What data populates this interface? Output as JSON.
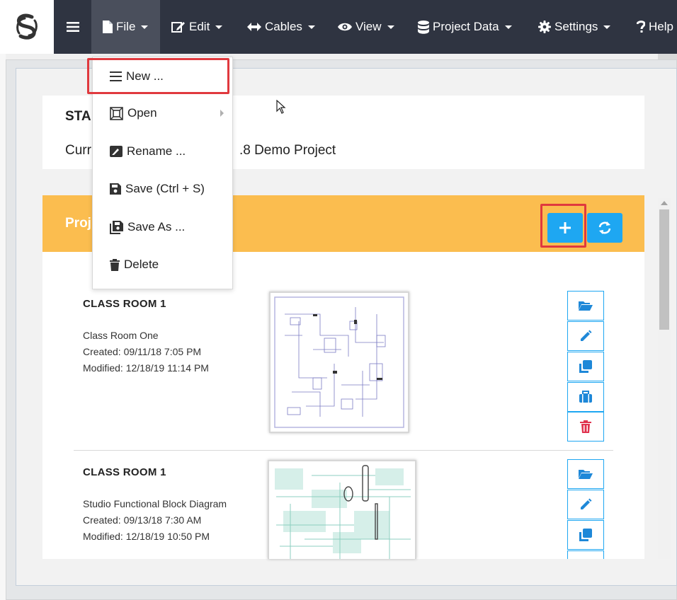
{
  "navbar": {
    "logo": "sd-logo-icon",
    "menu_toggle_icon": "hamburger-icon",
    "items": [
      {
        "label": "File",
        "icon": "file-icon"
      },
      {
        "label": "Edit",
        "icon": "edit-icon"
      },
      {
        "label": "Cables",
        "icon": "arrows-horizontal-icon"
      },
      {
        "label": "View",
        "icon": "eye-icon"
      },
      {
        "label": "Project Data",
        "icon": "database-icon"
      },
      {
        "label": "Settings",
        "icon": "gear-icon"
      },
      {
        "label": "Help",
        "icon": "question-icon"
      }
    ]
  },
  "file_menu": {
    "items": [
      {
        "label": "New ...",
        "icon": "list-icon",
        "highlighted": true
      },
      {
        "label": "Open",
        "icon": "open-icon",
        "has_submenu": true
      },
      {
        "label": "Rename ...",
        "icon": "rename-icon"
      },
      {
        "label": "Save (Ctrl + S)",
        "icon": "save-icon"
      },
      {
        "label": "Save As ...",
        "icon": "save-as-icon"
      },
      {
        "label": "Delete",
        "icon": "trash-icon"
      }
    ]
  },
  "status": {
    "title": "STA",
    "current": "Curr",
    "current_suffix": ".8 Demo Project"
  },
  "projects": {
    "title": "Proj",
    "add_button_icon": "plus-icon",
    "refresh_button_icon": "refresh-icon",
    "items": [
      {
        "name": "CLASS ROOM 1",
        "description": "Class Room One",
        "created": "Created: 09/11/18 7:05 PM",
        "modified": "Modified: 12/18/19 11:14 PM"
      },
      {
        "name": "CLASS ROOM 1",
        "description": "Studio Functional Block Diagram",
        "created": "Created: 09/13/18 7:30 AM",
        "modified": "Modified: 12/18/19 10:50 PM"
      }
    ],
    "row_actions": [
      "folder-open-icon",
      "pencil-icon",
      "copy-icon",
      "briefcase-icon",
      "trash-icon"
    ]
  },
  "colors": {
    "navbar": "#2f3441",
    "accent": "#1ea7f2",
    "header": "#fbbd4f",
    "highlight": "#e0393e",
    "danger": "#e0334f"
  }
}
